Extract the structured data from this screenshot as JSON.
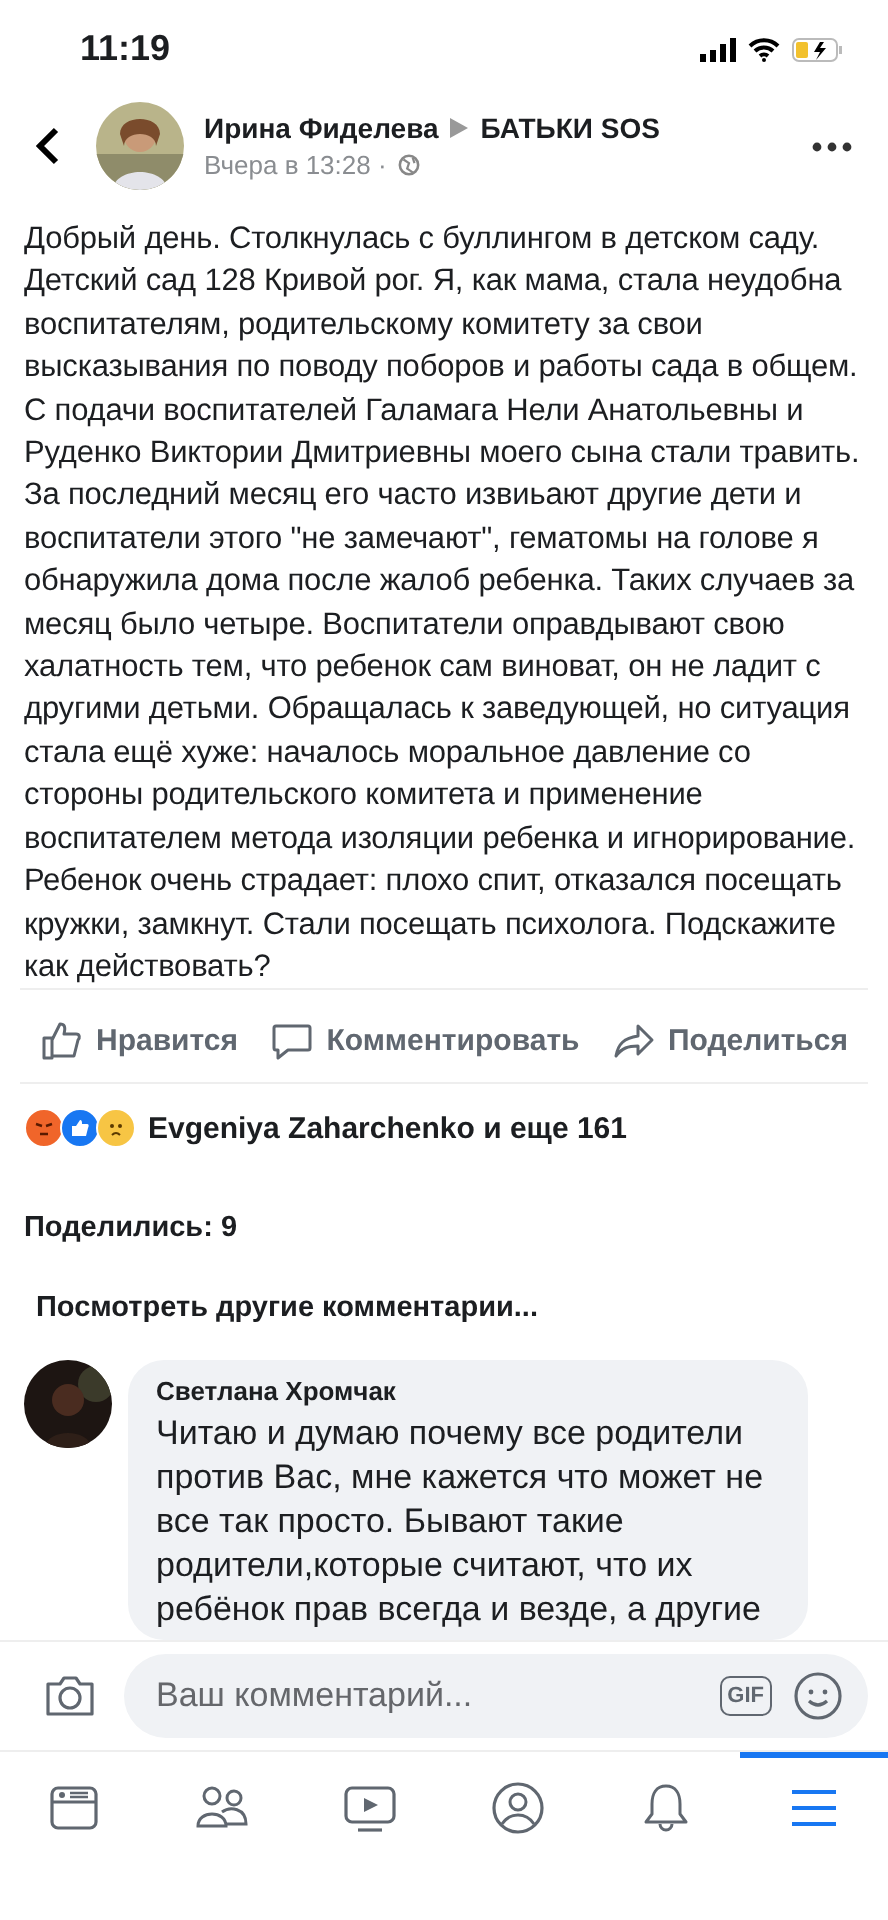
{
  "status_bar": {
    "time": "11:19"
  },
  "post": {
    "author": "Ирина Фиделева",
    "group": "БАТЬКИ SOS",
    "time": "Вчера в 13:28 ·",
    "text": "Добрый день. Столкнулась с буллингом в детском саду. Детский сад 128 Кривой рог. Я, как мама, стала неудобна воспитателям, родительскому комитету за свои высказывания по поводу поборов и работы сада в общем. С подачи воспитателей Галамага Нели Анатольевны и Руденко Виктории Дмитриевны моего сына стали травить. За последний месяц его часто извиьают другие дети и воспитатели этого \"не замечают\", гематомы на голове я обнаружила дома после жалоб ребенка. Таких случаев за месяц было четыре. Воспитатели оправдывают свою халатность тем, что ребенок сам виноват, он не ладит с другими детьми. Обращалась к заведующей, но ситуация стала ещё хуже: началось моральное давление со стороны родительского комитета и применение воспитателем метода изоляции ребенка и игнорирование. Ребенок очень страдает: плохо спит, отказался посещать кружки, замкнут. Стали посещать психолога. Подскажите как действовать?"
  },
  "actions": [
    {
      "kind": "like",
      "label": "Нравится"
    },
    {
      "kind": "comment",
      "label": "Комментировать"
    },
    {
      "kind": "share",
      "label": "Поделиться"
    }
  ],
  "reactions": {
    "icons": [
      {
        "kind": "angry",
        "color": "#f0652a"
      },
      {
        "kind": "like",
        "color": "#1877f2"
      },
      {
        "kind": "sad",
        "color": "#f7c544"
      }
    ],
    "text": "Evgeniya Zaharchenko и еще 161"
  },
  "shares": "Поделились: 9",
  "more_comments": "Посмотреть другие комментарии...",
  "comments": [
    {
      "author": "Светлана Хромчак",
      "text": "Читаю и  думаю почему все родители против Вас, мне кажется что может не все так просто. Бывают такие родители,которые считают, что их ребёнок прав всегда и везде, а другие"
    }
  ],
  "composer": {
    "placeholder": "Ваш комментарий...",
    "gif": "GIF"
  },
  "tabs": [
    {
      "kind": "feed",
      "selected": false
    },
    {
      "kind": "friends",
      "selected": false
    },
    {
      "kind": "watch",
      "selected": false
    },
    {
      "kind": "profile",
      "selected": false
    },
    {
      "kind": "bell",
      "selected": false
    },
    {
      "kind": "menu",
      "selected": true
    }
  ]
}
